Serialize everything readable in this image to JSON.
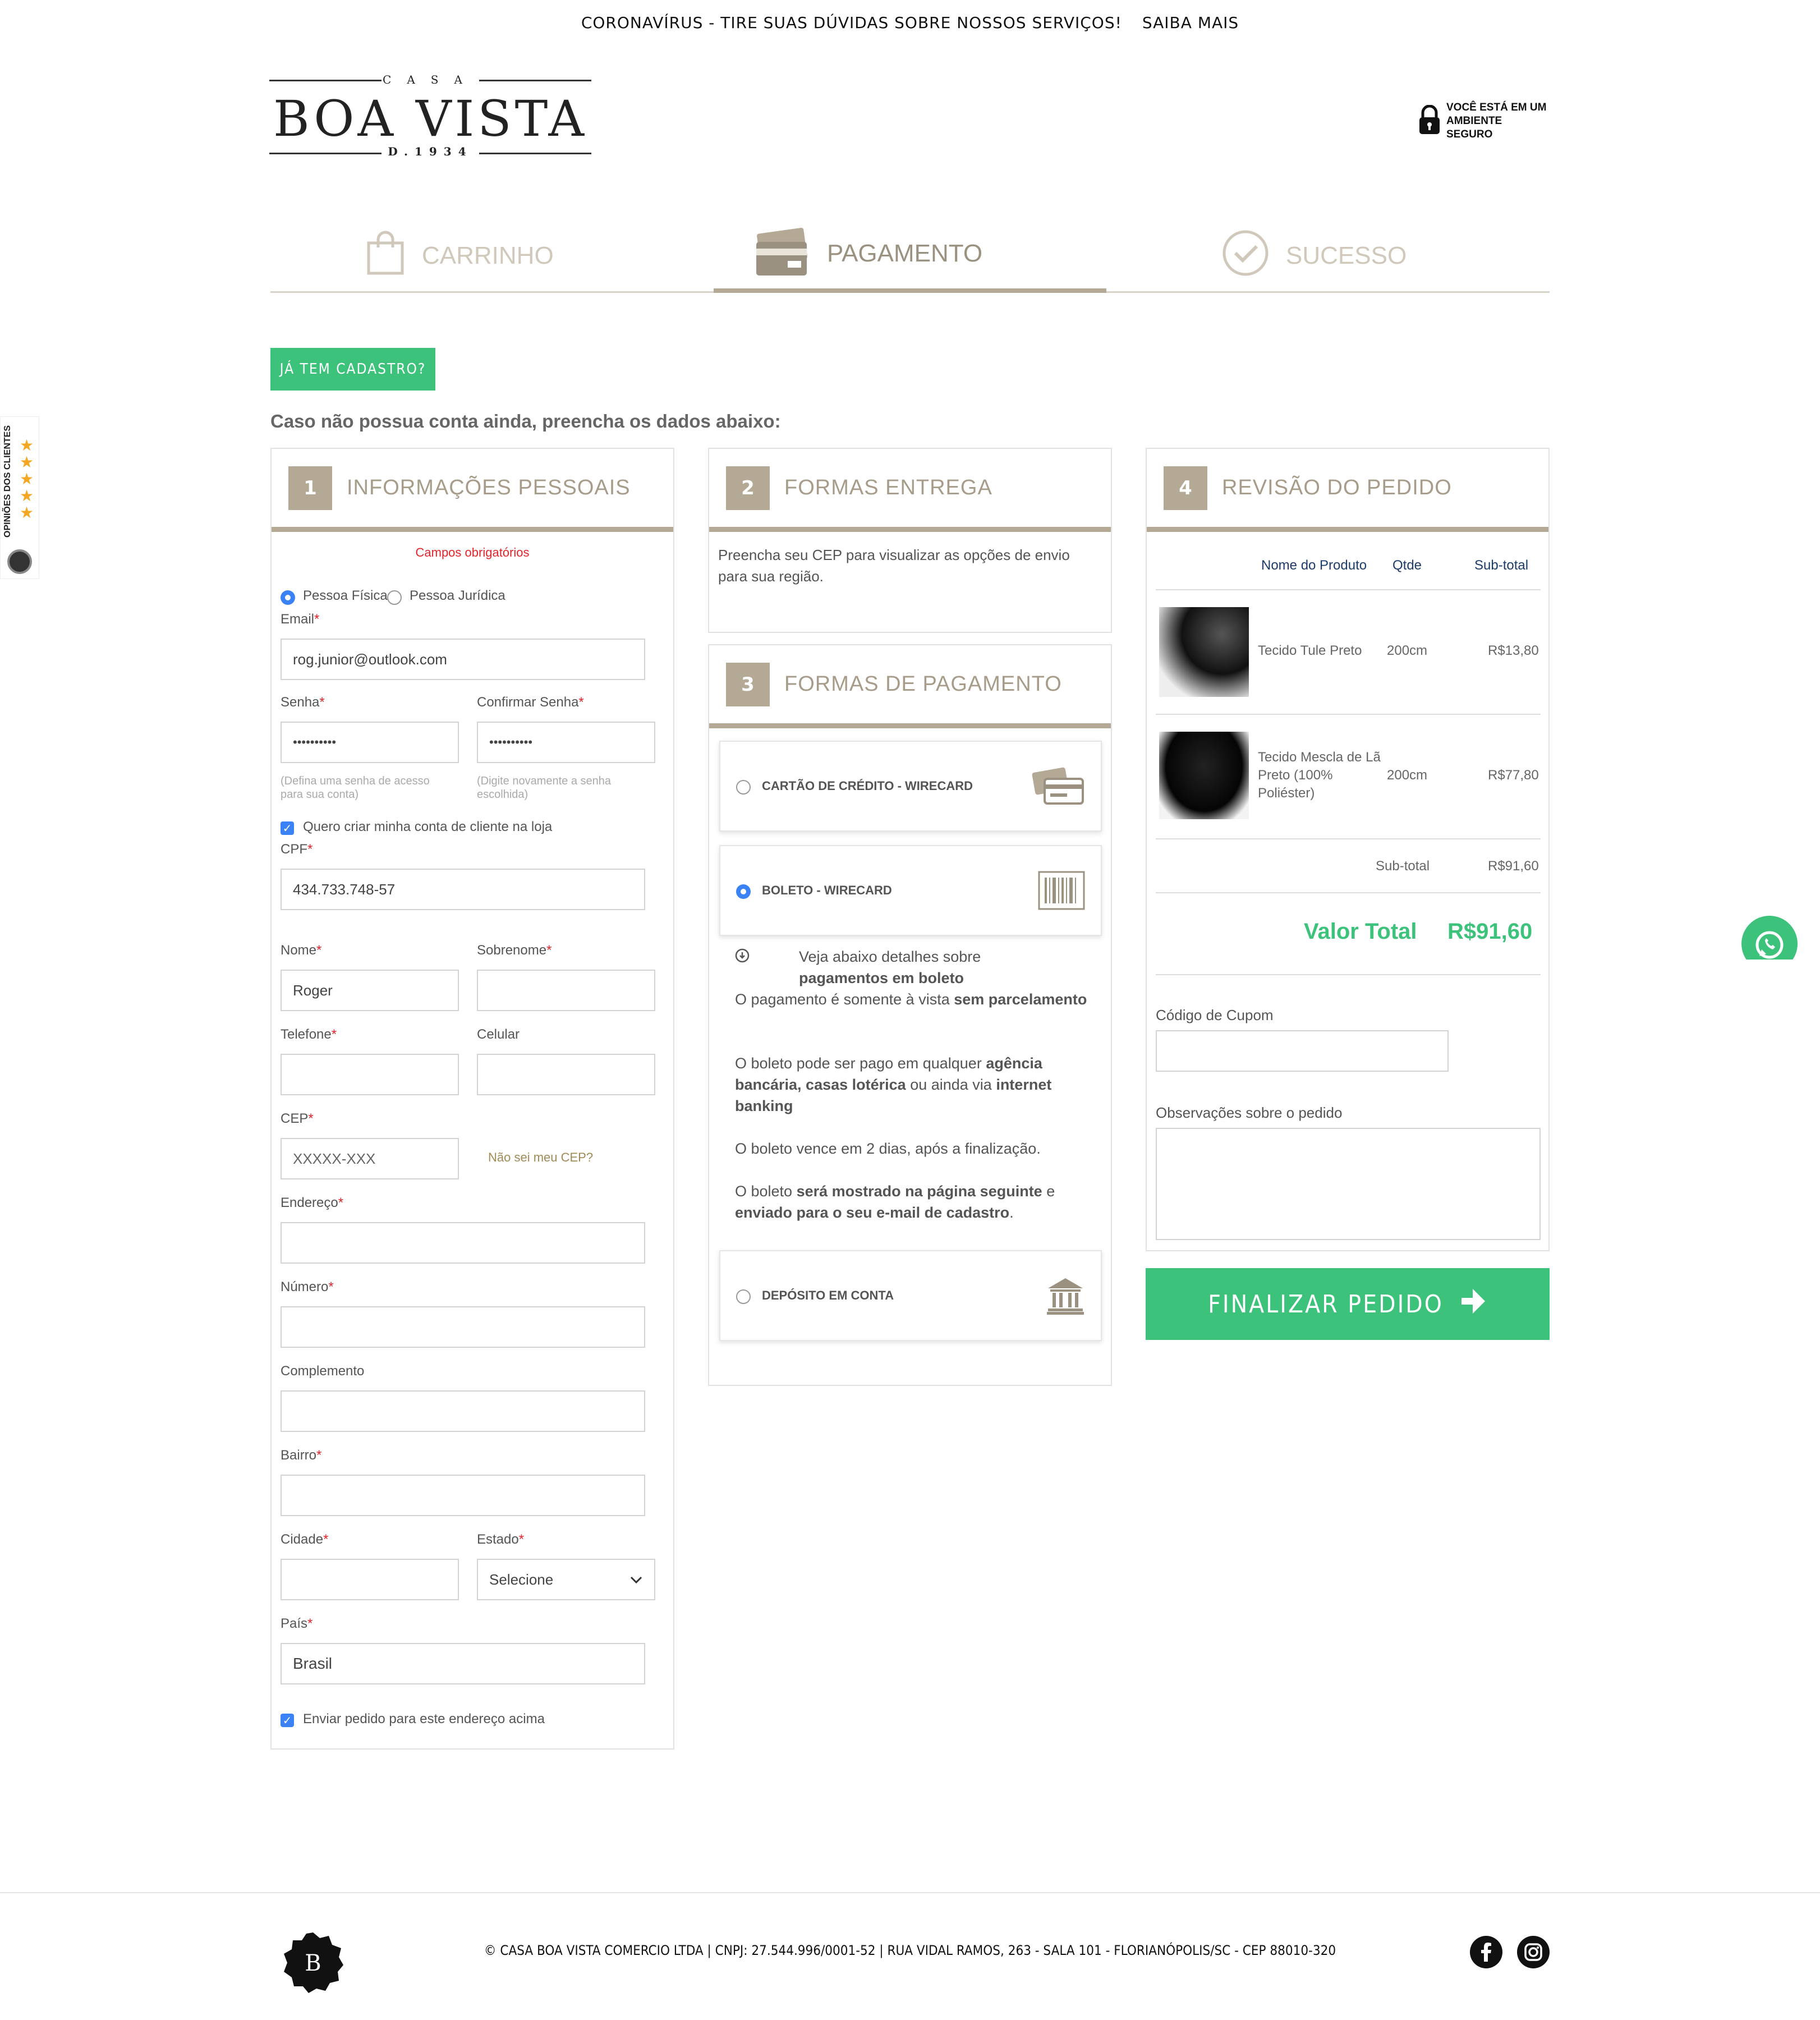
{
  "topbar": {
    "message": "CORONAVÍRUS - TIRE SUAS DÚVIDAS SOBRE NOSSOS SERVIÇOS!",
    "link": "SAIBA MAIS"
  },
  "brand": {
    "casa": "CASA",
    "name": "BOA VISTA",
    "since": "D.1934"
  },
  "secure": {
    "line1": "VOCÊ ESTÁ EM UM",
    "line2": "AMBIENTE SEGURO"
  },
  "steps": [
    {
      "label": "CARRINHO",
      "icon": "shopping-bag-icon"
    },
    {
      "label": "PAGAMENTO",
      "icon": "credit-card-icon"
    },
    {
      "label": "SUCESSO",
      "icon": "check-circle-icon"
    }
  ],
  "login_button": "JÁ TEM CADASTRO?",
  "intro": "Caso não possua conta ainda, preencha os dados abaixo:",
  "personal": {
    "number": "1",
    "title": "INFORMAÇÕES PESSOAIS",
    "required_note": "Campos obrigatórios",
    "pf": "Pessoa Física",
    "pj": "Pessoa Jurídica",
    "email_label": "Email",
    "email_value": "rog.junior@outlook.com",
    "senha_label": "Senha",
    "senha_value": "••••••••••",
    "confirmar_label": "Confirmar Senha",
    "confirmar_value": "••••••••••",
    "senha_hint": "(Defina uma senha de acesso para sua conta)",
    "confirmar_hint": "(Digite novamente a senha escolhida)",
    "criar_conta": "Quero criar minha conta de cliente na loja",
    "cpf_label": "CPF",
    "cpf_value": "434.733.748-57",
    "nome_label": "Nome",
    "nome_value": "Roger",
    "sobrenome_label": "Sobrenome",
    "telefone_label": "Telefone",
    "celular_label": "Celular",
    "cep_label": "CEP",
    "cep_placeholder": "XXXXX-XXX",
    "cep_help": "Não sei meu CEP?",
    "endereco_label": "Endereço",
    "numero_label": "Número",
    "complemento_label": "Complemento",
    "bairro_label": "Bairro",
    "cidade_label": "Cidade",
    "estado_label": "Estado",
    "estado_value": "Selecione",
    "pais_label": "País",
    "pais_value": "Brasil",
    "enviar": "Enviar pedido para este endereço acima",
    "required_mark": "*"
  },
  "shipping": {
    "number": "2",
    "title": "FORMAS ENTREGA",
    "text": "Preencha seu CEP para visualizar as opções de envio para sua região."
  },
  "payment": {
    "number": "3",
    "title": "FORMAS DE PAGAMENTO",
    "options": [
      {
        "label": "CARTÃO DE CRÉDITO - WIRECARD",
        "icon": "credit-cards-icon",
        "selected": false
      },
      {
        "label": "BOLETO - WIRECARD",
        "icon": "barcode-icon",
        "selected": true
      },
      {
        "label": "DEPÓSITO EM CONTA",
        "icon": "bank-icon",
        "selected": false
      }
    ],
    "detail_intro": "Veja abaixo detalhes sobre",
    "detail_intro_bold": "pagamentos em boleto",
    "p1_a": "O pagamento é somente à vista ",
    "p1_b": "sem parcelamento",
    "p2_a": "O boleto pode ser pago em qualquer ",
    "p2_b": "agência bancária, casas lotérica",
    "p2_c": " ou ainda via ",
    "p2_d": "internet banking",
    "p3": "O boleto vence em 2 dias, após a finalização.",
    "p4_a": "O boleto ",
    "p4_b": "será mostrado na página seguinte",
    "p4_c": " e ",
    "p4_d": "enviado para o seu e-mail de cadastro",
    "p4_e": "."
  },
  "review": {
    "number": "4",
    "title": "REVISÃO DO PEDIDO",
    "col_product": "Nome do Produto",
    "col_qty": "Qtde",
    "col_subtotal": "Sub-total",
    "items": [
      {
        "name": "Tecido Tule Preto",
        "qty": "200cm",
        "price": "R$13,80"
      },
      {
        "name": "Tecido Mescla de Lã Preto (100% Poliéster)",
        "qty": "200cm",
        "price": "R$77,80"
      }
    ],
    "subtotal_label": "Sub-total",
    "subtotal_value": "R$91,60",
    "total_label": "Valor Total",
    "total_value": "R$91,60",
    "cupom_label": "Código de Cupom",
    "obs_label": "Observações sobre o pedido"
  },
  "finalize": "FINALIZAR PEDIDO",
  "reviews_badge": "OPINIÕES DOS CLIENTES",
  "footer": {
    "text": "© CASA BOA VISTA COMERCIO LTDA | CNPJ: 27.544.996/0001-52 | RUA VIDAL RAMOS, 263 - SALA 101 - FLORIANÓPOLIS/SC - CEP 88010-320"
  },
  "colors": {
    "accent": "#b3a995",
    "green": "#3cc27b",
    "required": "#e0262b",
    "radio": "#3b82f6"
  }
}
